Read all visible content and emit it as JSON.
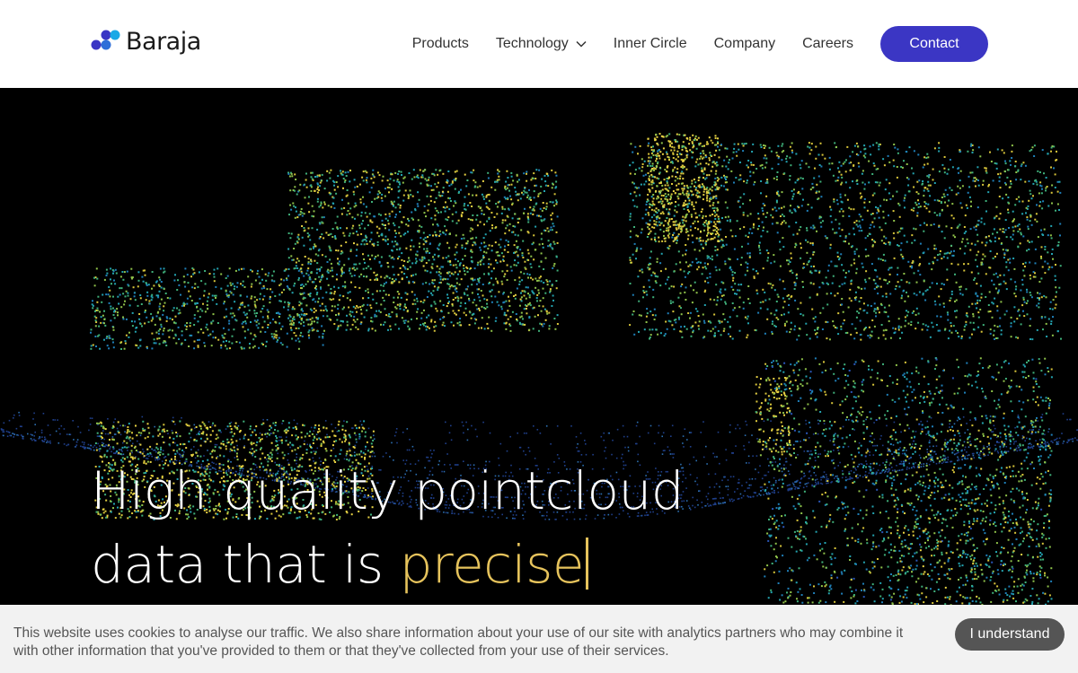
{
  "brand": {
    "name": "Baraja",
    "colors": {
      "dot_dark": "#3b36c4",
      "dot_light": "#19a9e6"
    }
  },
  "nav": {
    "items": [
      {
        "label": "Products"
      },
      {
        "label": "Technology",
        "has_dropdown": true,
        "icon": "chevron-down-icon"
      },
      {
        "label": "Inner Circle"
      },
      {
        "label": "Company"
      },
      {
        "label": "Careers"
      }
    ],
    "contact_label": "Contact",
    "accent_color": "#3b36c4"
  },
  "hero": {
    "headline_line1": "High quality pointcloud",
    "headline_line2_prefix": "data that is ",
    "headline_highlight": "precise",
    "highlight_color": "#e6c35c",
    "background": "lidar point cloud street scene"
  },
  "cookie_banner": {
    "text": "This website uses cookies to analyse our traffic. We also share information about your use of our site with analytics partners who may combine it with other information that you've provided to them or that they've collected from your use of their services.",
    "button_label": "I understand"
  }
}
